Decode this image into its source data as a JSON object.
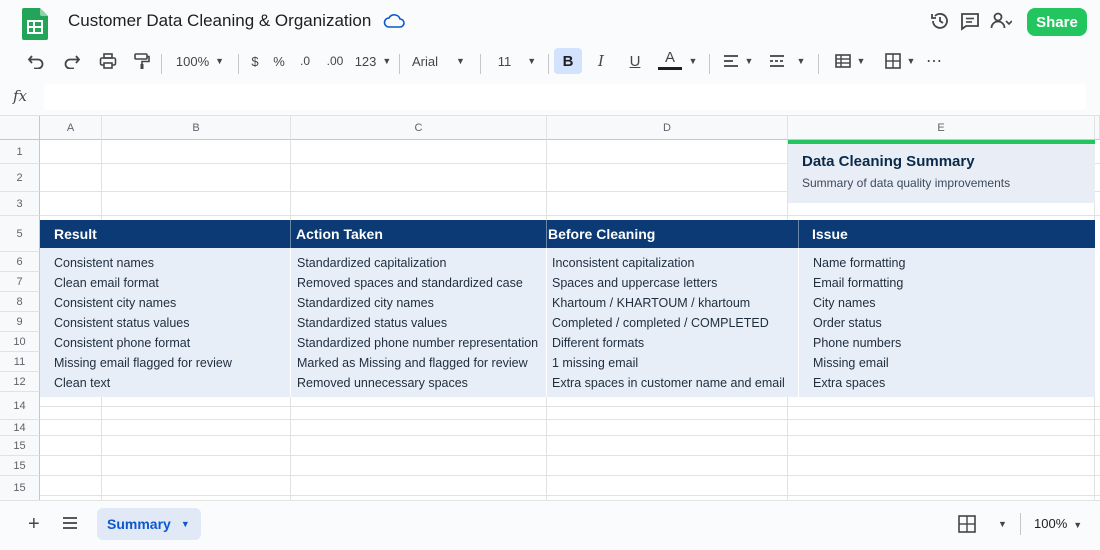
{
  "app": {
    "title": "Customer Data Cleaning & Organization",
    "share_label": "Share",
    "icons": [
      "sheets-logo-icon",
      "cloud-saved-icon",
      "version-history-icon",
      "comments-icon",
      "add-collaborator-icon"
    ]
  },
  "toolbar": {
    "zoom": "100%",
    "currency": "$",
    "percent": "%",
    "decrease_decimal": ".0",
    "increase_decimal": ".00",
    "more_formats": "123",
    "font": "Arial",
    "font_size": "11",
    "bold": "B",
    "italic": "I",
    "underline": "U",
    "text_color": "A",
    "more": "⋯"
  },
  "formula_bar": {
    "fx": "fx",
    "value": ""
  },
  "columns": [
    "A",
    "B",
    "C",
    "D",
    "E"
  ],
  "rows": [
    "1",
    "2",
    "3",
    "5",
    "6",
    "7",
    "8",
    "9",
    "10",
    "11",
    "12",
    "14",
    "14",
    "15",
    "15"
  ],
  "summary": {
    "title": "Data Cleaning Summary",
    "subtitle": "Summary of data quality improvements"
  },
  "table": {
    "headers": [
      "Result",
      "Action Taken",
      "Before Cleaning",
      "Issue"
    ],
    "rows": [
      [
        "Consistent names",
        "Standardized capitalization",
        "Inconsistent capitalization",
        "Name formatting"
      ],
      [
        "Clean email format",
        "Removed spaces and standardized case",
        "Spaces and uppercase letters",
        "Email formatting"
      ],
      [
        "Consistent city names",
        "Standardized city names",
        "Khartoum / KHARTOUM / khartoum",
        "City names"
      ],
      [
        "Consistent status values",
        "Standardized status values",
        "Completed / completed / COMPLETED",
        "Order status"
      ],
      [
        "Consistent phone format",
        "Standardized phone number representation",
        "Different formats",
        "Phone numbers"
      ],
      [
        "Missing email flagged for review",
        "Marked as Missing and flagged for review",
        "1 missing email",
        "Missing email"
      ],
      [
        "Clean text",
        "Removed unnecessary spaces",
        "Extra spaces in customer name and email",
        "Extra spaces"
      ]
    ]
  },
  "sheets": {
    "active": "Summary"
  },
  "bottom": {
    "zoom": "100%"
  },
  "colors": {
    "header_band": "#0b3a74",
    "body_band": "#e8eef7",
    "accent_green": "#22c55e",
    "sheet_tab_text": "#0b57d0"
  }
}
